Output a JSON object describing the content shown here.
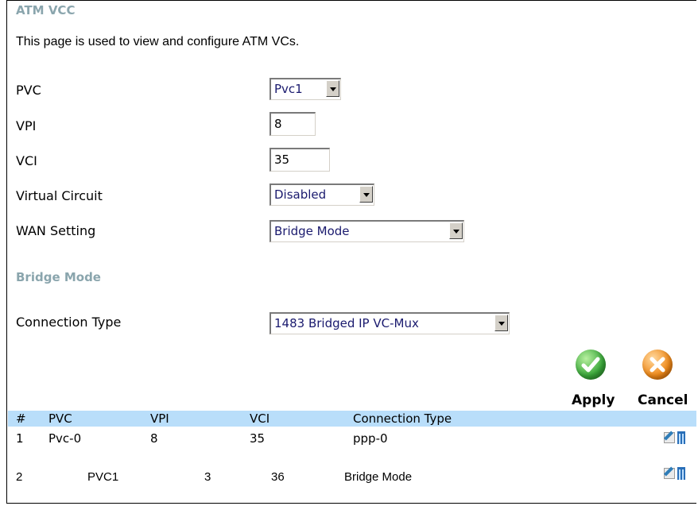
{
  "page": {
    "title": "ATM VCC",
    "description": "This page is used to view and configure ATM VCs."
  },
  "form": {
    "pvc": {
      "label": "PVC",
      "value": "Pvc1"
    },
    "vpi": {
      "label": "VPI",
      "value": "8"
    },
    "vci": {
      "label": "VCI",
      "value": "35"
    },
    "virtual_circuit": {
      "label": "Virtual Circuit",
      "value": "Disabled"
    },
    "wan_setting": {
      "label": "WAN Setting",
      "value": "Bridge Mode"
    }
  },
  "bridge": {
    "title": "Bridge Mode",
    "connection_type": {
      "label": "Connection Type",
      "value": "1483 Bridged IP VC-Mux"
    }
  },
  "buttons": {
    "apply_label": "Apply",
    "cancel_label": "Cancel"
  },
  "colors": {
    "section_title": "#8aa5ad",
    "table_header_bg": "#b9defa",
    "apply_icon": "#3aa83a",
    "cancel_icon": "#f08a1a"
  },
  "table": {
    "headers": [
      "#",
      "PVC",
      "VPI",
      "VCI",
      "Connection Type"
    ],
    "rows": [
      [
        "1",
        "Pvc-0",
        "8",
        "35",
        "ppp-0"
      ],
      [
        "2",
        "PVC1",
        "3",
        "36",
        "Bridge Mode"
      ]
    ]
  }
}
